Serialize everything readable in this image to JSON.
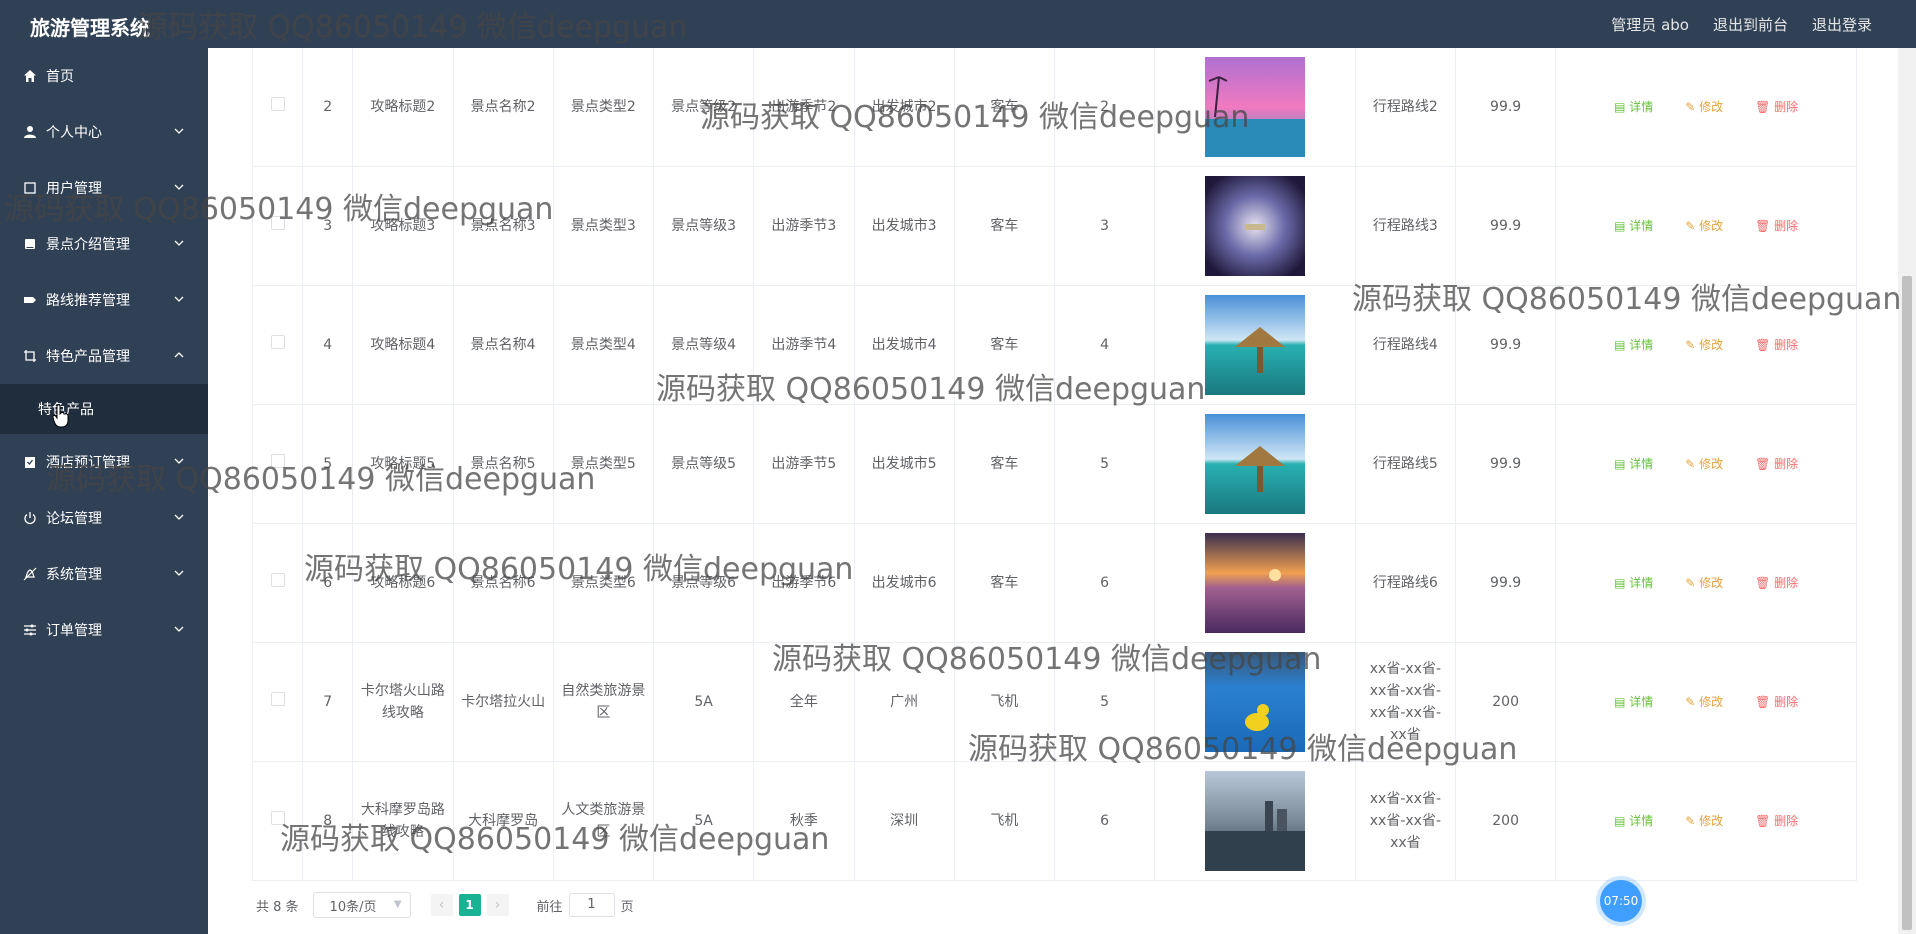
{
  "app_title": "旅游管理系统",
  "top_links": [
    "管理员 abo",
    "退出到前台",
    "退出登录"
  ],
  "sidebar": {
    "items": [
      {
        "label": "首页",
        "icon": "home-icon",
        "chevron": ""
      },
      {
        "label": "个人中心",
        "icon": "user-icon",
        "chevron": "down"
      },
      {
        "label": "用户管理",
        "icon": "user-manage-icon",
        "chevron": "down"
      },
      {
        "label": "景点介绍管理",
        "icon": "book-icon",
        "chevron": "down"
      },
      {
        "label": "路线推荐管理",
        "icon": "route-icon",
        "chevron": "down"
      },
      {
        "label": "特色产品管理",
        "icon": "crop-icon",
        "chevron": "up"
      },
      {
        "label": "特色产品",
        "sub": true
      },
      {
        "label": "酒店预订管理",
        "icon": "hotel-icon",
        "chevron": "down"
      },
      {
        "label": "论坛管理",
        "icon": "power-icon",
        "chevron": "down"
      },
      {
        "label": "系统管理",
        "icon": "bell-off-icon",
        "chevron": "down"
      },
      {
        "label": "订单管理",
        "icon": "sliders-icon",
        "chevron": "down"
      }
    ]
  },
  "table": {
    "actions": {
      "detail": "详情",
      "edit": "修改",
      "delete": "删除"
    },
    "rows": [
      {
        "id": "2",
        "title": "攻略标题2",
        "spot": "景点名称2",
        "type": "景点类型2",
        "level": "景点等级2",
        "season": "出游季节2",
        "city": "出发城市2",
        "transport": "客车",
        "days": "2",
        "image": "sunset-pool",
        "route": "行程路线2",
        "price": "99.9"
      },
      {
        "id": "3",
        "title": "攻略标题3",
        "spot": "景点名称3",
        "type": "景点类型3",
        "level": "景点等级3",
        "season": "出游季节3",
        "city": "出发城市3",
        "transport": "客车",
        "days": "3",
        "image": "night-sky",
        "route": "行程路线3",
        "price": "99.9"
      },
      {
        "id": "4",
        "title": "攻略标题4",
        "spot": "景点名称4",
        "type": "景点类型4",
        "level": "景点等级4",
        "season": "出游季节4",
        "city": "出发城市4",
        "transport": "客车",
        "days": "4",
        "image": "beach-hut",
        "route": "行程路线4",
        "price": "99.9"
      },
      {
        "id": "5",
        "title": "攻略标题5",
        "spot": "景点名称5",
        "type": "景点类型5",
        "level": "景点等级5",
        "season": "出游季节5",
        "city": "出发城市5",
        "transport": "客车",
        "days": "5",
        "image": "beach-hut",
        "route": "行程路线5",
        "price": "99.9"
      },
      {
        "id": "6",
        "title": "攻略标题6",
        "spot": "景点名称6",
        "type": "景点类型6",
        "level": "景点等级6",
        "season": "出游季节6",
        "city": "出发城市6",
        "transport": "客车",
        "days": "6",
        "image": "lavender",
        "route": "行程路线6",
        "price": "99.9"
      },
      {
        "id": "7",
        "title": "卡尔塔火山路线攻略",
        "spot": "卡尔塔拉火山",
        "type": "自然类旅游景区",
        "level": "5A",
        "season": "全年",
        "city": "广州",
        "transport": "飞机",
        "days": "5",
        "image": "duck-pool",
        "route": "xx省-xx省-xx省-xx省-xx省-xx省-xx省",
        "price": "200"
      },
      {
        "id": "8",
        "title": "大科摩罗岛路线攻略",
        "spot": "大科摩罗岛",
        "type": "人文类旅游景区",
        "level": "5A",
        "season": "秋季",
        "city": "深圳",
        "transport": "飞机",
        "days": "6",
        "image": "lake-city",
        "route": "xx省-xx省-xx省-xx省-xx省",
        "price": "200"
      }
    ]
  },
  "pagination": {
    "total": "共 8 条",
    "page_size": "10条/页",
    "prev": "‹",
    "current": "1",
    "next": "›",
    "goto_label": "前往",
    "goto_value": "1",
    "goto_suffix": "页"
  },
  "clock": "07:50",
  "watermark": "源码获取 QQ86050149 微信deepguan",
  "colors": {
    "sidebar": "#304156",
    "sub_active": "#1f2d3d",
    "accent": "#19b394",
    "detail": "#67c23a",
    "edit": "#e6a23c",
    "delete": "#f56c6c"
  }
}
